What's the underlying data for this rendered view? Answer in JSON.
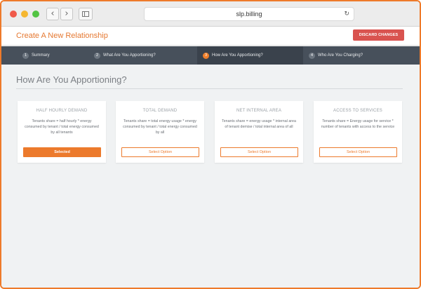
{
  "browser": {
    "url": "slp.billing",
    "back_icon": "‹",
    "forward_icon": "›",
    "reload_icon": "↻"
  },
  "header": {
    "title": "Create A New Relationship",
    "discard_label": "DISCARD CHANGES"
  },
  "steps": [
    {
      "number": "1",
      "label": "Summary"
    },
    {
      "number": "2",
      "label": "What Are You Apportioning?"
    },
    {
      "number": "3",
      "label": "How Are You Apportioning?"
    },
    {
      "number": "4",
      "label": "Who Are You Charging?"
    }
  ],
  "main": {
    "title": "How Are You Apportioning?",
    "options": [
      {
        "title": "HALF HOURLY DEMAND",
        "description": "Tenants share = half hourly * energy consumed by tenant / total energy consumed by all tenants",
        "button": "Selected"
      },
      {
        "title": "TOTAL DEMAND",
        "description": "Tenants share = total energy usage * energy consumed by tenant / total energy consumed by all",
        "button": "Select Option"
      },
      {
        "title": "NET INTERNAL AREA",
        "description": "Tenants share = energy usage * internal area of tenant demise / total internal area of all",
        "button": "Select Option"
      },
      {
        "title": "ACCESS TO SERVICES",
        "description": "Tenants share = Energy usage for service * number of tenants with access to the service",
        "button": "Select Option"
      }
    ]
  },
  "colors": {
    "accent": "#ec7a2c",
    "danger": "#d9534f",
    "steps_bg": "#47505b"
  }
}
